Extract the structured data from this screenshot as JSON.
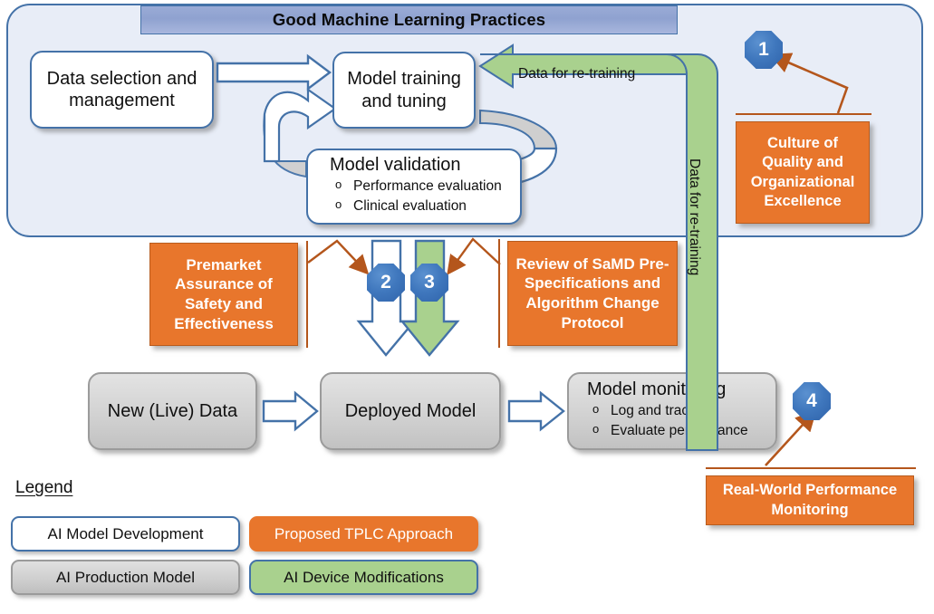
{
  "diagram": {
    "title": "Good Machine Learning Practices",
    "gmlp_section": {
      "boxes": {
        "data_selection": "Data selection and management",
        "model_training": "Model training and tuning",
        "model_validation_title": "Model validation",
        "model_validation_items": [
          "Performance evaluation",
          "Clinical evaluation"
        ]
      }
    },
    "production_section": {
      "new_live_data": "New (Live) Data",
      "deployed_model": "Deployed  Model",
      "model_monitoring_title": "Model monitoring",
      "model_monitoring_items": [
        "Log and track",
        "Evaluate performance"
      ]
    },
    "tplc_boxes": [
      {
        "id": 1,
        "label": "Culture of Quality and Organizational Excellence"
      },
      {
        "id": 2,
        "label": "Premarket Assurance of Safety and Effectiveness"
      },
      {
        "id": 3,
        "label": "Review of SaMD Pre-Specifications and Algorithm Change Protocol"
      },
      {
        "id": 4,
        "label": "Real-World Performance Monitoring"
      }
    ],
    "badges": [
      {
        "number": "1"
      },
      {
        "number": "2"
      },
      {
        "number": "3"
      },
      {
        "number": "4"
      }
    ],
    "arrow_labels": {
      "retraining_horizontal": "Data for re-training",
      "retraining_vertical": "Data for re-training"
    },
    "legend": {
      "title": "Legend",
      "items": [
        {
          "label": "AI Model Development",
          "swatch": "#ffffff"
        },
        {
          "label": "Proposed TPLC Approach",
          "swatch": "#e8762c"
        },
        {
          "label": "AI Production Model",
          "swatch": "#cfcfcf"
        },
        {
          "label": "AI Device Modifications",
          "swatch": "#a9d18e"
        }
      ]
    },
    "colors": {
      "container_fill": "#e8edf7",
      "container_border": "#4472a8",
      "title_banner": "#9aabd6",
      "orange": "#e8762c",
      "orange_border": "#b4561c",
      "green": "#a9d18e",
      "gray": "#cfcfcf",
      "badge_blue": "#3f77bd",
      "arrow_blue": "#4472a8"
    }
  }
}
